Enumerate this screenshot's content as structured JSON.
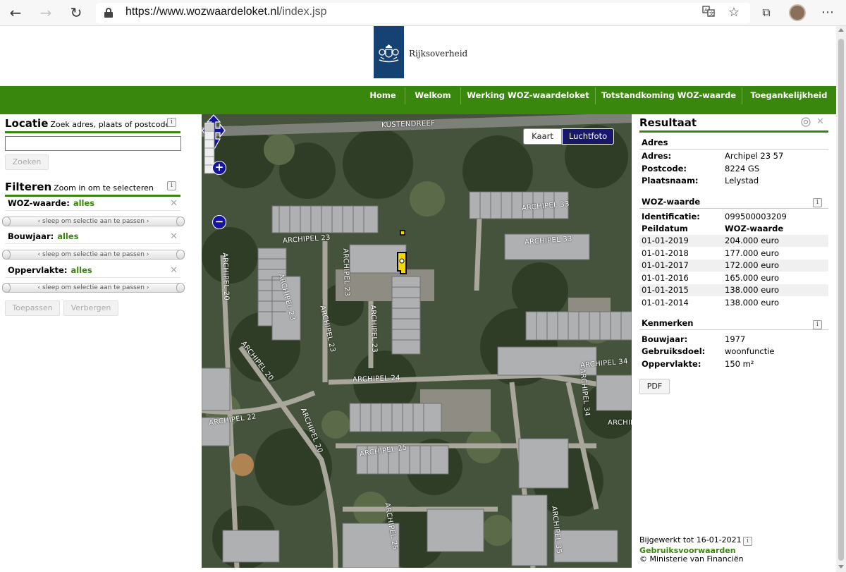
{
  "browser": {
    "url_host": "https://www.wozwaardeloket.nl",
    "url_path": "/index.jsp",
    "back_icon": "←",
    "forward_icon": "→",
    "refresh_icon": "↻",
    "translate_icon": "translate-icon",
    "favorite_icon": "☆",
    "collections_icon": "⧉",
    "menu_icon": "⋯"
  },
  "header": {
    "logo_text": "Rijksoverheid"
  },
  "nav": {
    "items": [
      {
        "label": "Home"
      },
      {
        "label": "Welkom"
      },
      {
        "label": "Werking WOZ-waardeloket"
      },
      {
        "label": "Totstandkoming WOZ-waarde"
      },
      {
        "label": "Toegankelijkheid"
      }
    ]
  },
  "locatie": {
    "title": "Locatie",
    "subtitle": "Zoek adres, plaats of postcode",
    "info": "i",
    "input_value": "",
    "search_button": "Zoeken"
  },
  "filteren": {
    "title": "Filteren",
    "subtitle": "Zoom in om te selecteren",
    "info": "i",
    "slider_text": "‹ sleep om selectie aan te passen ›",
    "filters": [
      {
        "label": "WOZ-waarde:",
        "value": "alles"
      },
      {
        "label": "Bouwjaar:",
        "value": "alles"
      },
      {
        "label": "Oppervlakte:",
        "value": "alles"
      }
    ],
    "apply_button": "Toepassen",
    "hide_button": "Verbergen"
  },
  "map": {
    "toggle_kaart": "Kaart",
    "toggle_luchtfoto": "Luchtfoto",
    "zoom_in": "+",
    "zoom_out": "−",
    "street_labels": {
      "kustendreef": "KUSTENDREEF",
      "archipel33a": "ARCHIPEL 33",
      "archipel33b": "ARCHIPEL 33",
      "archipel23a": "ARCHIPEL 23",
      "archipel23b": "ARCHIPEL 23",
      "archipel23c": "ARCHIPEL 23",
      "archipel23d": "ARCHIPEL 23",
      "archipel23e": "ARCHIPEL 23",
      "archipel20a": "ARCHIPEL 20",
      "archipel20b": "ARCHIPEL 20",
      "archipel20c": "ARCHIPEL 20",
      "archipel22": "ARCHIPEL 22",
      "archipel24": "ARCHIPEL 24",
      "archipel25a": "ARCHIPEL 25",
      "archipel25b": "ARCHIPEL 25",
      "archipel34a": "ARCHIPEL 34",
      "archipel34b": "ARCHIPEL 34",
      "archipel35": "ARCHIPEL 35",
      "archipel_edge": "ARCHIPEL"
    }
  },
  "result": {
    "title": "Resultaat",
    "adres_head": "Adres",
    "adres_rows": [
      {
        "k": "Adres:",
        "v": "Archipel 23 57"
      },
      {
        "k": "Postcode:",
        "v": "8224 GS"
      },
      {
        "k": "Plaatsnaam:",
        "v": "Lelystad"
      }
    ],
    "woz_head": "WOZ-waarde",
    "identificatie_label": "Identificatie:",
    "identificatie_value": "099500003209",
    "peildatum_label": "Peildatum",
    "wozwaarde_label": "WOZ-waarde",
    "woz_rows": [
      {
        "date": "01-01-2019",
        "value": "204.000 euro"
      },
      {
        "date": "01-01-2018",
        "value": "177.000 euro"
      },
      {
        "date": "01-01-2017",
        "value": "172.000 euro"
      },
      {
        "date": "01-01-2016",
        "value": "165.000 euro"
      },
      {
        "date": "01-01-2015",
        "value": "138.000 euro"
      },
      {
        "date": "01-01-2014",
        "value": "138.000 euro"
      }
    ],
    "kenmerken_head": "Kenmerken",
    "kenmerken_rows": [
      {
        "k": "Bouwjaar:",
        "v": "1977"
      },
      {
        "k": "Gebruiksdoel:",
        "v": "woonfunctie"
      },
      {
        "k": "Oppervlakte:",
        "v": "150 m²"
      }
    ],
    "pdf_button": "PDF",
    "updated": "Bijgewerkt tot 16-01-2021",
    "terms_link": "Gebruiksvoorwaarden",
    "copyright": "© Ministerie van Financiën",
    "info": "i"
  }
}
